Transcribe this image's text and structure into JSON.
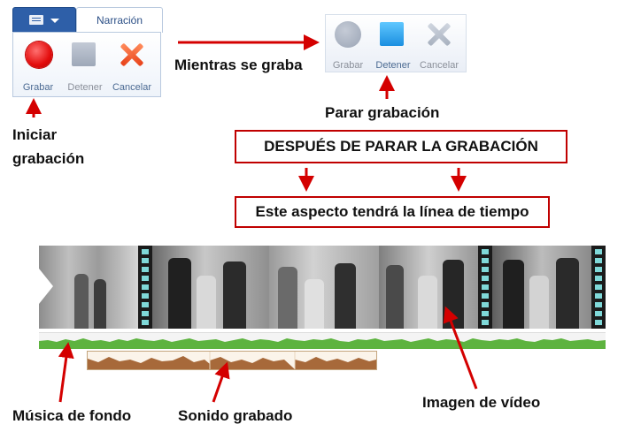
{
  "ribbon": {
    "tab_label": "Narración",
    "buttons": {
      "record": "Grabar",
      "stop": "Detener",
      "cancel": "Cancelar"
    }
  },
  "ribbon_recording": {
    "buttons": {
      "record": "Grabar",
      "stop": "Detener",
      "cancel": "Cancelar"
    }
  },
  "annotations": {
    "while_recording": "Mientras se graba",
    "stop_recording": "Parar grabación",
    "start_recording_line1": "Iniciar",
    "start_recording_line2": "grabación",
    "after_stop": "DESPUÉS DE PARAR LA GRABACIÓN",
    "timeline_look": "Este aspecto tendrá la línea de tiempo",
    "background_music": "Música de fondo",
    "recorded_sound": "Sonido grabado",
    "video_image": "Imagen de vídeo"
  },
  "colors": {
    "arrow": "#d40000",
    "record": "#e30d0d",
    "stop_active": "#1b8fe0",
    "music_wave": "#5db33f",
    "voice_wave": "#a7693a"
  }
}
